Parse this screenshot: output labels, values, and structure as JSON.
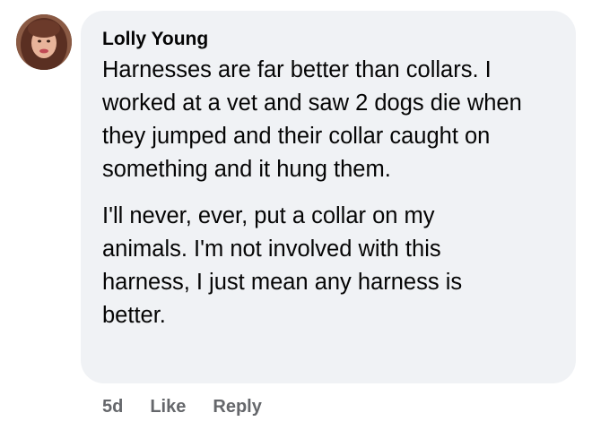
{
  "comment": {
    "author": "Lolly Young",
    "paragraphs": [
      "Harnesses are far better than collars. I worked at a vet and saw 2 dogs die when they jumped and their collar caught on something and it hung them.",
      "I'll never, ever, put a collar on my animals. I'm not involved with this harness, I just mean any harness is better."
    ],
    "timestamp": "5d",
    "like_label": "Like",
    "reply_label": "Reply"
  },
  "colors": {
    "bubble": "#f0f2f5",
    "text": "#050505",
    "secondary": "#65676b"
  },
  "icons": {
    "avatar": "profile-photo"
  }
}
